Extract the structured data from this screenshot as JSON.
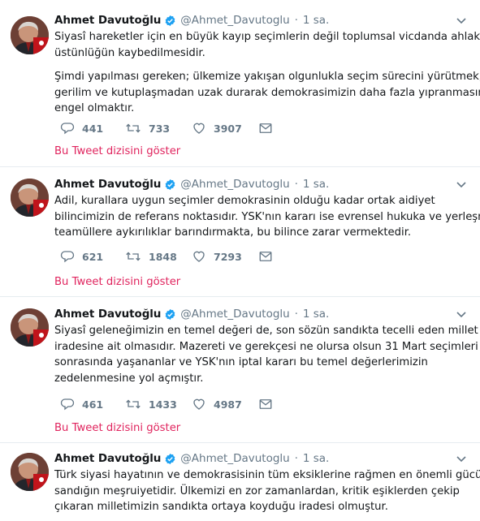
{
  "tweets": [
    {
      "author": "Ahmet Davutoğlu",
      "handle": "@Ahmet_Davutoglu",
      "dot": "·",
      "time": "1 sa.",
      "lines": [
        "Siyasî hareketler için en büyük kayıp seçimlerin değil toplumsal vicdanda ahlakî",
        "üstünlüğün kaybedilmesidir.",
        "Şimdi yapılması gereken; ülkemize yakışan olgunlukla seçim sürecini yürütmek,",
        "gerilim ve kutuplaşmadan uzak durarak demokrasimizin daha fazla yıpranmasına",
        "engel olmaktır."
      ],
      "replies": "441",
      "retweets": "733",
      "likes": "3907",
      "show_thread": "Bu Tweet dizisini göster"
    },
    {
      "author": "Ahmet Davutoğlu",
      "handle": "@Ahmet_Davutoglu",
      "dot": "·",
      "time": "1 sa.",
      "lines": [
        "Adil, kurallara uygun seçimler demokrasinin olduğu kadar ortak aidiyet",
        "bilincimizin de referans noktasıdır. YSK'nın kararı ise evrensel hukuka ve yerleşmiş",
        "teamüllere aykırılıklar barındırmakta, bu bilince zarar vermektedir."
      ],
      "replies": "621",
      "retweets": "1848",
      "likes": "7293",
      "show_thread": "Bu Tweet dizisini göster"
    },
    {
      "author": "Ahmet Davutoğlu",
      "handle": "@Ahmet_Davutoglu",
      "dot": "·",
      "time": "1 sa.",
      "lines": [
        "Siyasî geleneğimizin en temel değeri de, son sözün sandıkta tecelli eden millet",
        "iradesine ait olmasıdır. Mazereti ve gerekçesi ne olursa olsun 31 Mart seçimleri",
        "sonrasında yaşananlar ve YSK'nın iptal kararı bu temel değerlerimizin",
        "zedelenmesine yol açmıştır."
      ],
      "replies": "461",
      "retweets": "1433",
      "likes": "4987",
      "show_thread": "Bu Tweet dizisini göster"
    },
    {
      "author": "Ahmet Davutoğlu",
      "handle": "@Ahmet_Davutoglu",
      "dot": "·",
      "time": "1 sa.",
      "lines": [
        "Türk siyasi hayatının ve demokrasisinin tüm eksiklerine rağmen en önemli gücü",
        "sandığın meşruiyetidir. Ülkemizi en zor zamanlardan, kritik eşiklerden çekip",
        "çıkaran milletimizin sandıkta ortaya koyduğu iradesi olmuştur."
      ]
    }
  ],
  "colors": {
    "text": "#14171a",
    "muted": "#657786",
    "link": "#e0245e",
    "verified": "#1da1f2",
    "divider": "#e6ecf0"
  },
  "icons": [
    "reply-icon",
    "retweet-icon",
    "like-icon",
    "dm-icon",
    "verified-badge-icon",
    "chevron-down-icon",
    "avatar"
  ]
}
